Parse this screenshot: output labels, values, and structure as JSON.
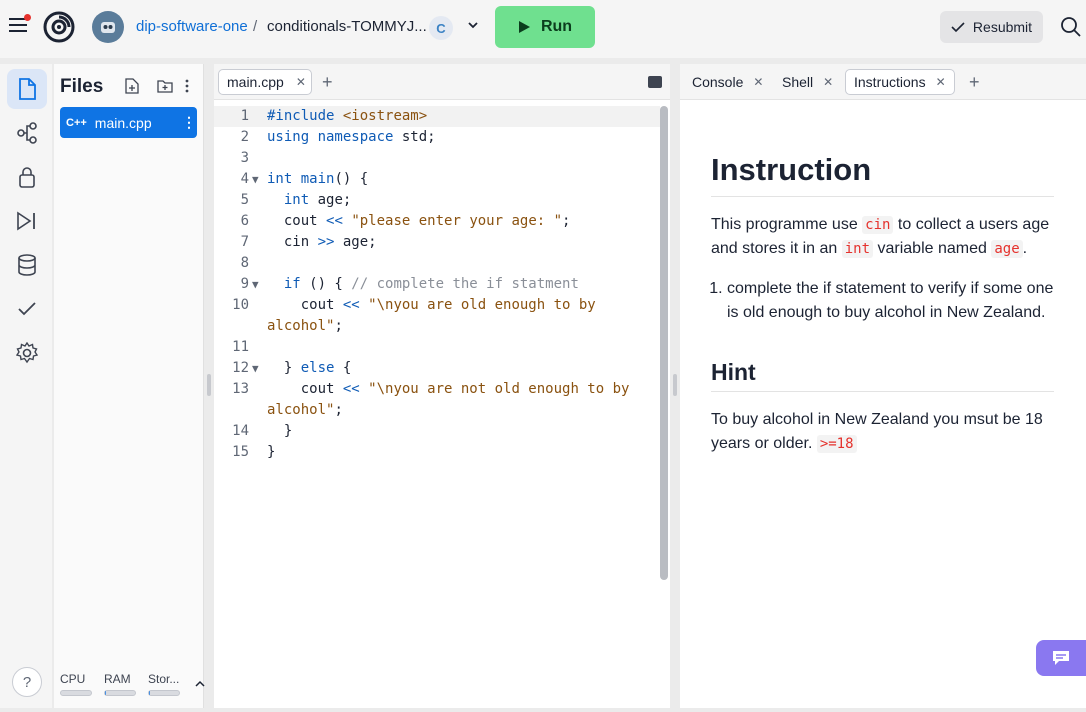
{
  "topbar": {
    "owner": "dip-software-one",
    "separator": "/",
    "repl_name": "conditionals-TOMMYJ...",
    "lang_badge": "C",
    "run_label": "Run",
    "resubmit_label": "Resubmit"
  },
  "files_panel": {
    "title": "Files",
    "file_icon_label": "C++",
    "file_name": "main.cpp",
    "resources": [
      {
        "label": "CPU",
        "level": 0
      },
      {
        "label": "RAM",
        "level": 0.04
      },
      {
        "label": "Stor...",
        "level": 0.04
      }
    ],
    "help_label": "?"
  },
  "editor": {
    "tab_label": "main.cpp",
    "lines": [
      {
        "n": "1",
        "fold": "",
        "html": "<span class=\"kw\">#include</span> <span class=\"str\">&lt;iostream&gt;</span>"
      },
      {
        "n": "2",
        "fold": "",
        "html": "<span class=\"kw\">using namespace</span> std;"
      },
      {
        "n": "3",
        "fold": "",
        "html": ""
      },
      {
        "n": "4",
        "fold": "▼",
        "html": "<span class=\"ty\">int</span> <span class=\"kw\">main</span>() {"
      },
      {
        "n": "5",
        "fold": "",
        "html": "  <span class=\"ty\">int</span> age;"
      },
      {
        "n": "6",
        "fold": "",
        "html": "  cout <span class=\"kw\">&lt;&lt;</span> <span class=\"str\">\"please enter your age: \"</span>;"
      },
      {
        "n": "7",
        "fold": "",
        "html": "  cin <span class=\"kw\">&gt;&gt;</span> age;"
      },
      {
        "n": "8",
        "fold": "",
        "html": ""
      },
      {
        "n": "9",
        "fold": "▼",
        "html": "  <span class=\"kw\">if</span> () { <span class=\"cm\">// complete the if statment</span>"
      },
      {
        "n": "10",
        "fold": "",
        "html": "    cout <span class=\"kw\">&lt;&lt;</span> <span class=\"str\">\"\\nyou are old enough to by</span>"
      },
      {
        "n": "",
        "fold": "",
        "html": "<span class=\"str\">alcohol\"</span>;"
      },
      {
        "n": "11",
        "fold": "",
        "html": ""
      },
      {
        "n": "12",
        "fold": "▼",
        "html": "  } <span class=\"kw\">else</span> {"
      },
      {
        "n": "13",
        "fold": "",
        "html": "    cout <span class=\"kw\">&lt;&lt;</span> <span class=\"str\">\"\\nyou are not old enough to by</span>"
      },
      {
        "n": "",
        "fold": "",
        "html": "<span class=\"str\">alcohol\"</span>;"
      },
      {
        "n": "14",
        "fold": "",
        "html": "  }"
      },
      {
        "n": "15",
        "fold": "",
        "html": "}"
      }
    ]
  },
  "right_panel": {
    "tabs": [
      {
        "label": "Console"
      },
      {
        "label": "Shell"
      },
      {
        "label": "Instructions"
      }
    ],
    "heading": "Instruction",
    "intro_a": "This programme use ",
    "intro_code1": "cin",
    "intro_b": " to collect a users age and stores it in an ",
    "intro_code2": "int",
    "intro_c": " variable named ",
    "intro_code3": "age",
    "intro_d": ".",
    "step_1": "complete the if statement to verify if some one is old enough to buy alcohol in New Zealand.",
    "hint_heading": "Hint",
    "hint_text": "To buy alcohol in New Zealand you msut be 18 years or older. ",
    "hint_code": ">=18"
  },
  "colors": {
    "run_green": "#6fe08f",
    "accent_blue": "#0f74e4",
    "chat_purple": "#8a78f0"
  }
}
